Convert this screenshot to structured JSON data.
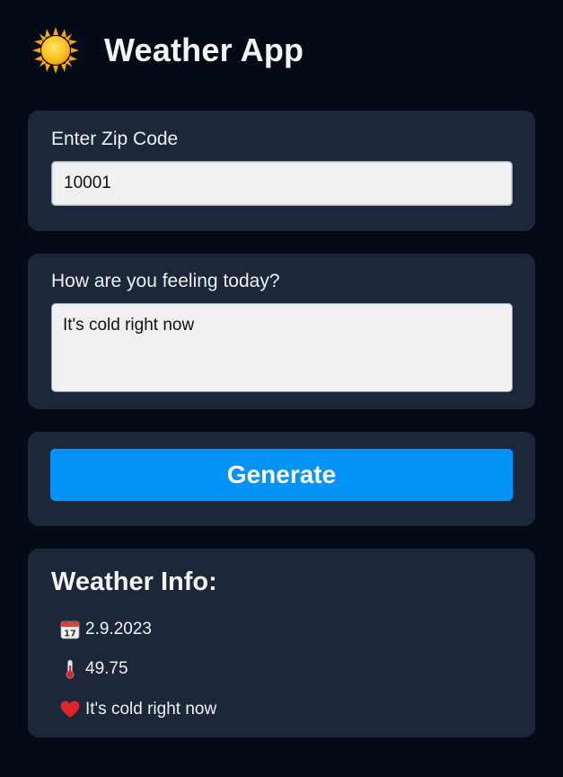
{
  "header": {
    "icon": "sun-icon",
    "title": "Weather App"
  },
  "zip": {
    "label": "Enter Zip Code",
    "value": "10001"
  },
  "feeling": {
    "label": "How are you feeling today?",
    "value": "It's cold right now"
  },
  "generate": {
    "label": "Generate",
    "color": "#0392f5"
  },
  "info": {
    "title": "Weather Info:",
    "date": {
      "icon": "calendar-icon",
      "value": "2.9.2023"
    },
    "temperature": {
      "icon": "thermometer-icon",
      "value": "49.75"
    },
    "feeling": {
      "icon": "heart-icon",
      "value": "It's cold right now"
    }
  },
  "colors": {
    "background": "#050b16",
    "card": "#1c2839",
    "accent": "#0392f5"
  }
}
